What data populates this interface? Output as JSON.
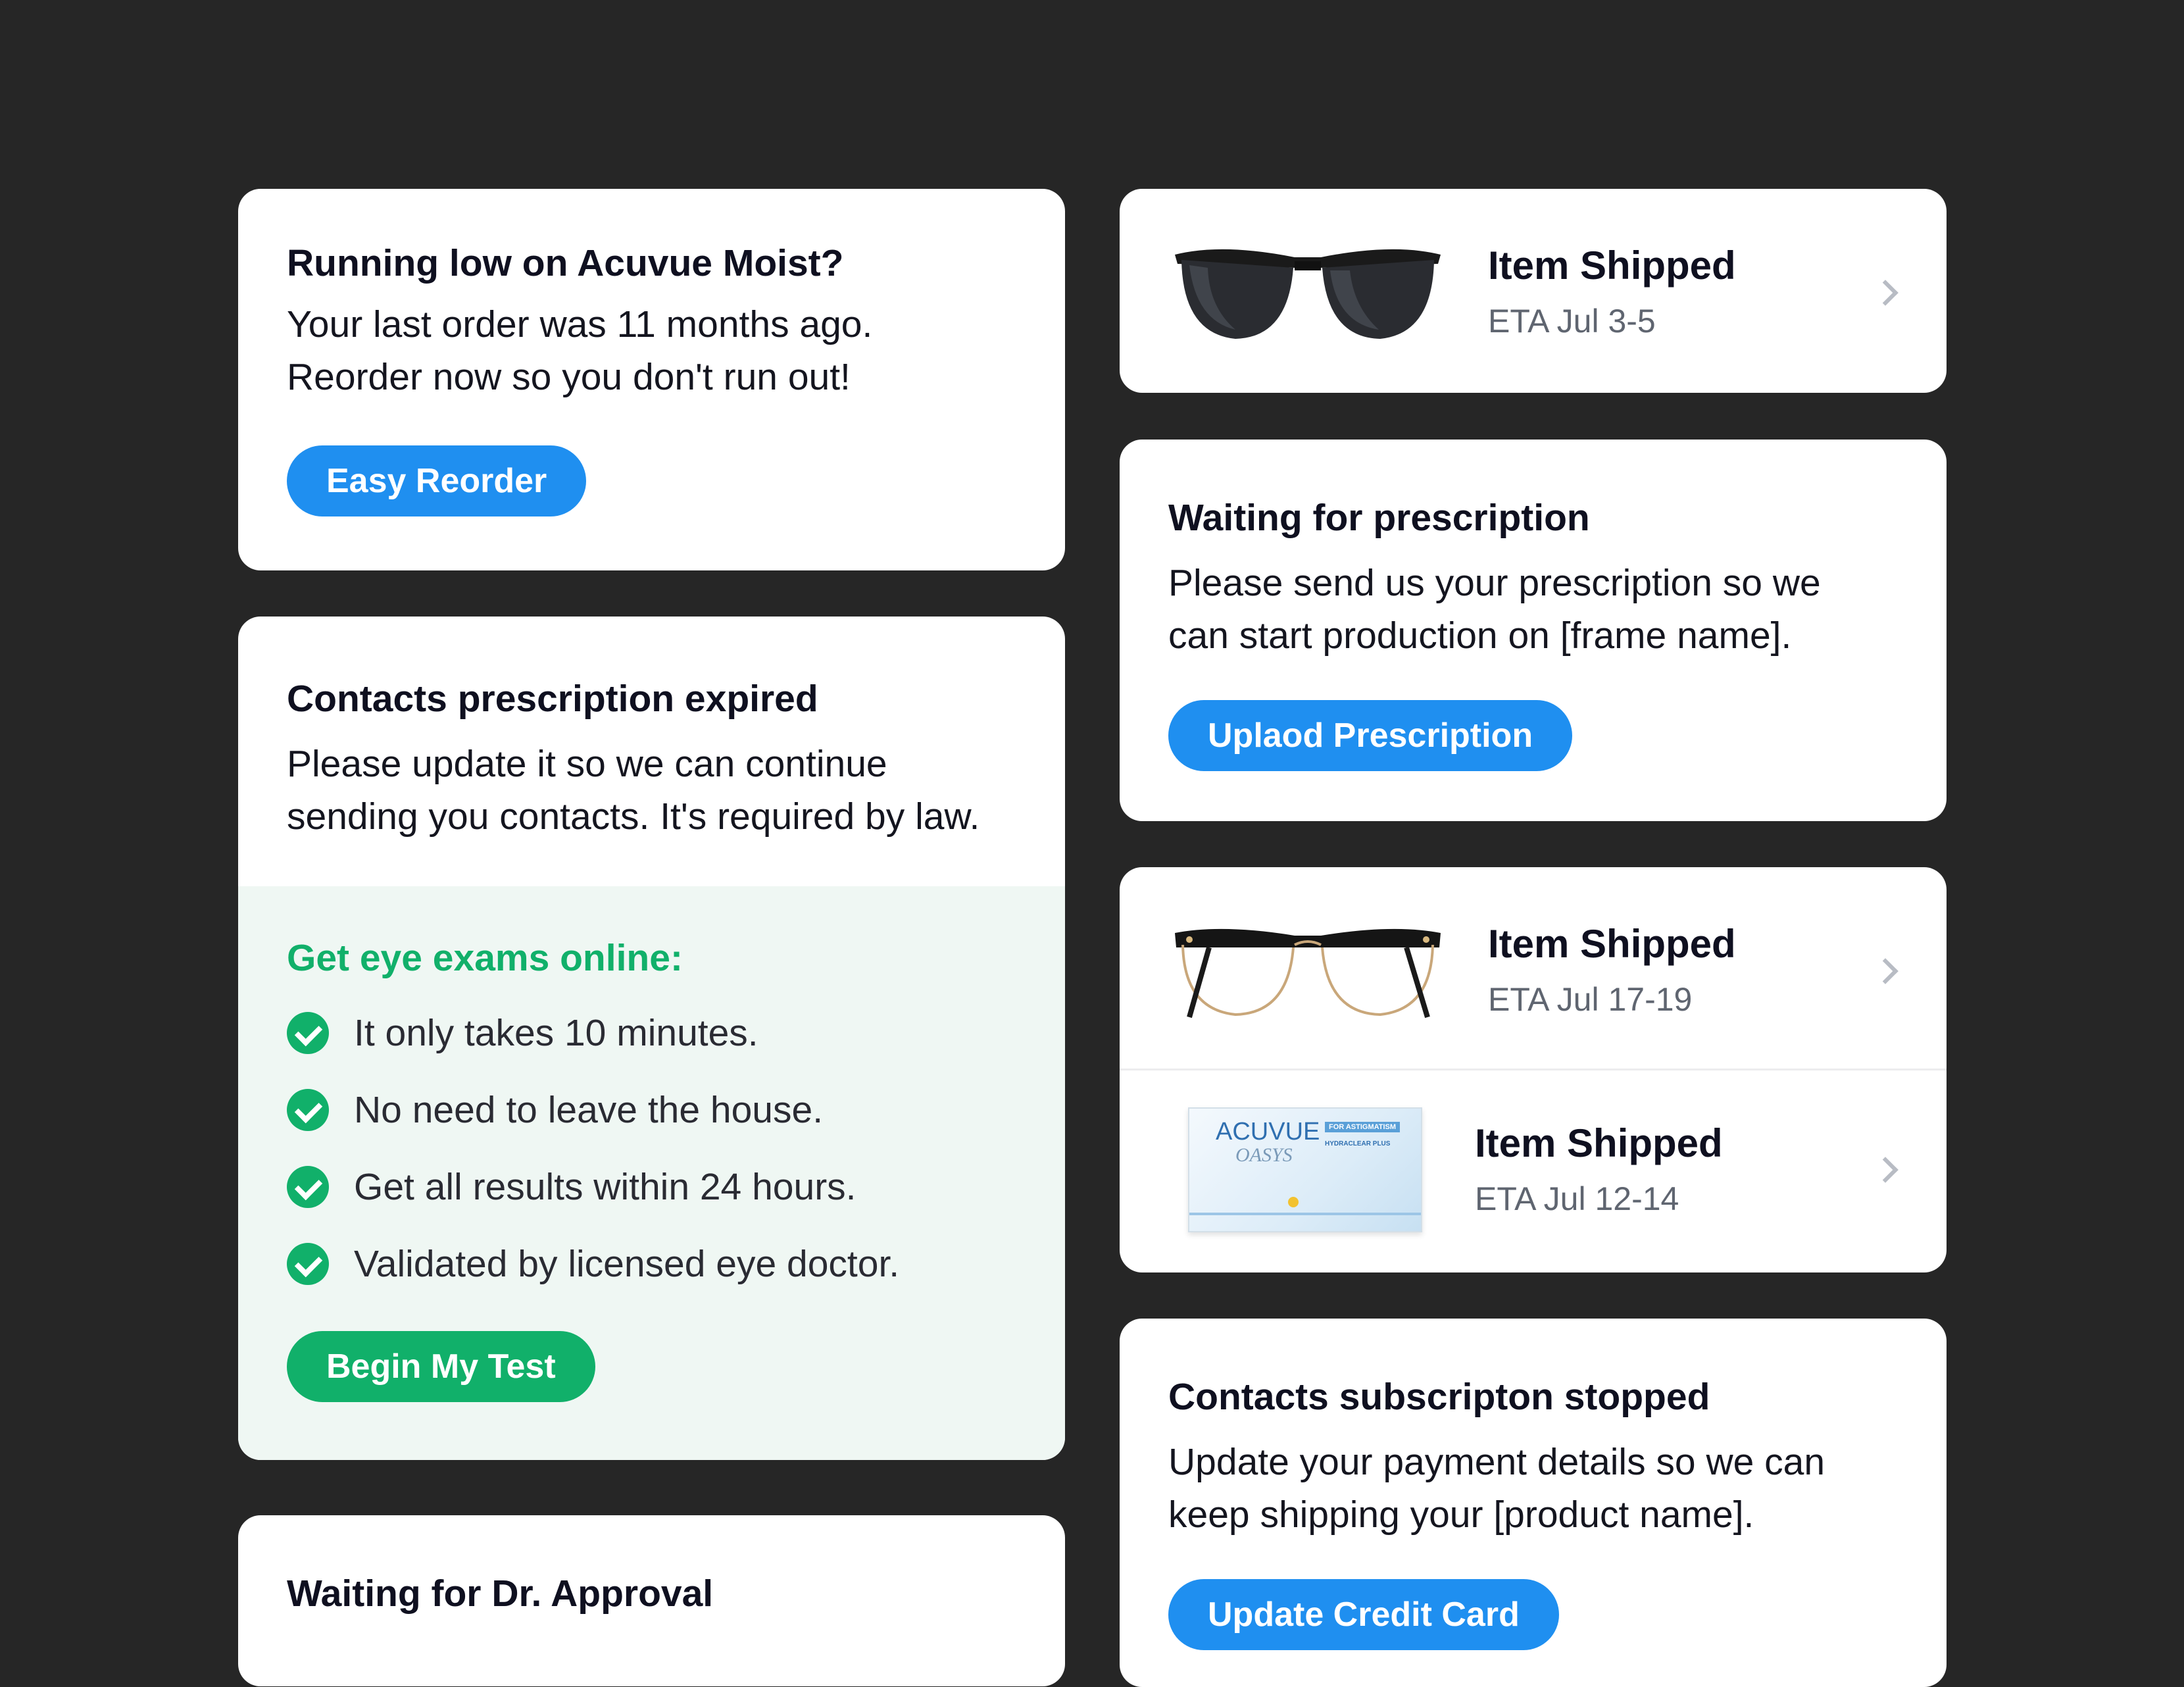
{
  "reorder": {
    "title": "Running low on Acuvue Moist?",
    "line1": "Your last order was 11 months ago.",
    "line2": "Reorder now so you don't run out!",
    "button": "Easy Reorder"
  },
  "expired": {
    "title": "Contacts prescription expired",
    "line1": "Please update it so we can continue",
    "line2": "sending you contacts. It's required by law.",
    "exam_title": "Get eye exams online:",
    "benefits": [
      "It only takes 10 minutes.",
      "No need to leave the house.",
      "Get all results within 24 hours.",
      "Validated by licensed eye doctor."
    ],
    "button": "Begin My Test"
  },
  "approval": {
    "title": "Waiting for Dr. Approval"
  },
  "shipped1": {
    "title": "Item Shipped",
    "eta": "ETA Jul 3-5"
  },
  "prescription": {
    "title": "Waiting for prescription",
    "line1": "Please send us your prescription so we",
    "line2": "can start production on [frame name].",
    "button": "Uplaod Prescription"
  },
  "shipped2": {
    "title": "Item Shipped",
    "eta": "ETA Jul 17-19"
  },
  "shipped3": {
    "title": "Item Shipped",
    "eta": "ETA Jul 12-14",
    "box_brand": "ACUVUE",
    "box_line": "OASYS",
    "box_tag": "FOR ASTIGMATISM",
    "box_feature": "HYDRACLEAR PLUS"
  },
  "subscription": {
    "title": "Contacts subscripton stopped",
    "line1": "Update your payment details so we can",
    "line2": "keep shipping your [product name].",
    "button": "Update Credit Card"
  },
  "colors": {
    "background": "#262626",
    "card": "#ffffff",
    "primary": "#1f8ff0",
    "success": "#11b06a",
    "exam_bg": "#eff7f3"
  },
  "icons": [
    "sunglasses-image",
    "eyeglasses-image",
    "contact-lens-box-image",
    "chevron-right-icon",
    "check-circle-icon"
  ]
}
